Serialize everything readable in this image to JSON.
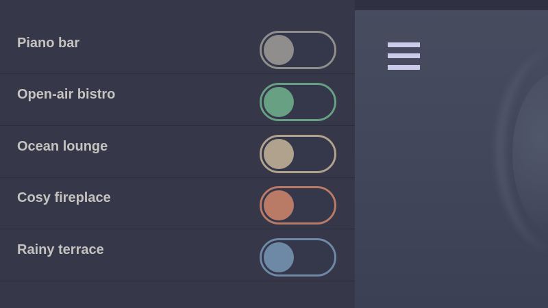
{
  "sidebar": {
    "items": [
      {
        "label": "Piano bar",
        "color": "#8f8e8c",
        "enabled": false
      },
      {
        "label": "Open-air bistro",
        "color": "#67a083",
        "enabled": false
      },
      {
        "label": "Ocean lounge",
        "color": "#b0a28c",
        "enabled": false
      },
      {
        "label": "Cosy fireplace",
        "color": "#b97a66",
        "enabled": false
      },
      {
        "label": "Rainy terrace",
        "color": "#6e89a6",
        "enabled": false
      }
    ]
  },
  "menu": {
    "icon": "hamburger-menu-icon",
    "color": "#c9cbe8"
  }
}
